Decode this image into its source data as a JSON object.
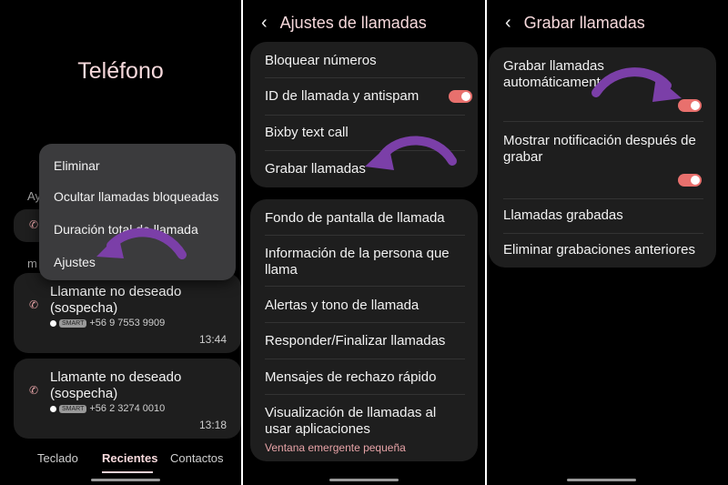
{
  "panel1": {
    "title": "Teléfono",
    "partial_label_1": "Ay",
    "partial_label_2": "m",
    "menu": [
      "Eliminar",
      "Ocultar llamadas bloqueadas",
      "Duración total de llamada",
      "Ajustes"
    ],
    "calls": [
      {
        "name": "Llamante no deseado (sospecha)",
        "badge": "SMART",
        "number": "+56 9 7553 9909",
        "time": "13:44"
      },
      {
        "name": "Llamante no deseado (sospecha)",
        "badge": "SMART",
        "number": "+56 2 3274 0010",
        "time": "13:18"
      }
    ],
    "tabs": [
      "Teclado",
      "Recientes",
      "Contactos"
    ]
  },
  "panel2": {
    "title": "Ajustes de llamadas",
    "group1": [
      "Bloquear números",
      "ID de llamada y antispam",
      "Bixby text call",
      "Grabar llamadas"
    ],
    "group2": [
      "Fondo de pantalla de llamada",
      "Información de la persona que llama",
      "Alertas y tono de llamada",
      "Responder/Finalizar llamadas",
      "Mensajes de rechazo rápido",
      "Visualización de llamadas al usar aplicaciones"
    ],
    "popup_sub": "Ventana emergente pequeña"
  },
  "panel3": {
    "title": "Grabar llamadas",
    "items": [
      "Grabar llamadas automáticamente",
      "Mostrar notificación después de grabar",
      "Llamadas grabadas",
      "Eliminar grabaciones anteriores"
    ]
  },
  "colors": {
    "accent_pink": "#f7d9dc",
    "toggle_on": "#e8706d",
    "annotation_arrow": "#7b3fa8"
  }
}
